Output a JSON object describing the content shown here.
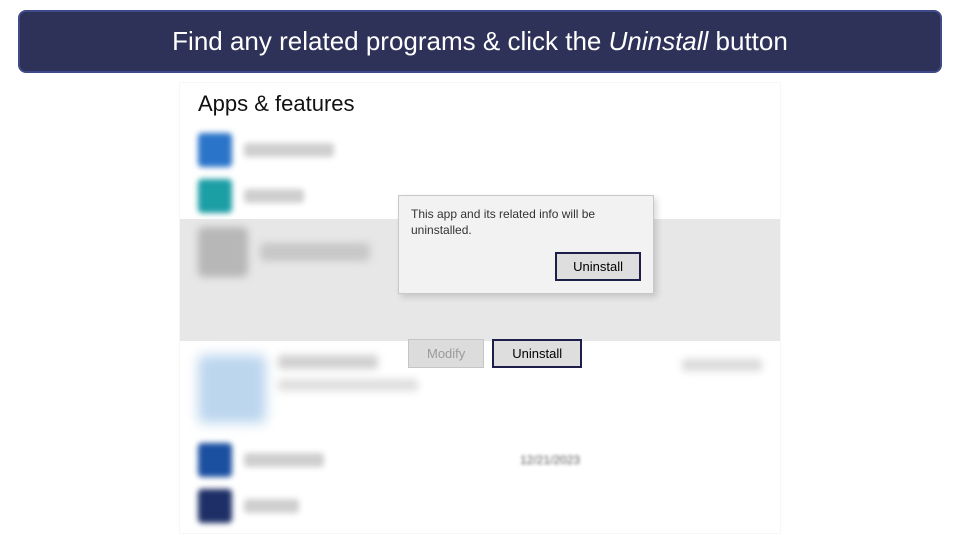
{
  "banner": {
    "prefix": "Find any related programs & click the ",
    "italic": "Uninstall",
    "suffix": " button"
  },
  "page": {
    "title": "Apps & features"
  },
  "tooltip": {
    "message": "This app and its related info will be uninstalled.",
    "confirm_label": "Uninstall"
  },
  "actions": {
    "modify_label": "Modify",
    "uninstall_label": "Uninstall"
  },
  "rows": {
    "date_example": "12/21/2023"
  }
}
